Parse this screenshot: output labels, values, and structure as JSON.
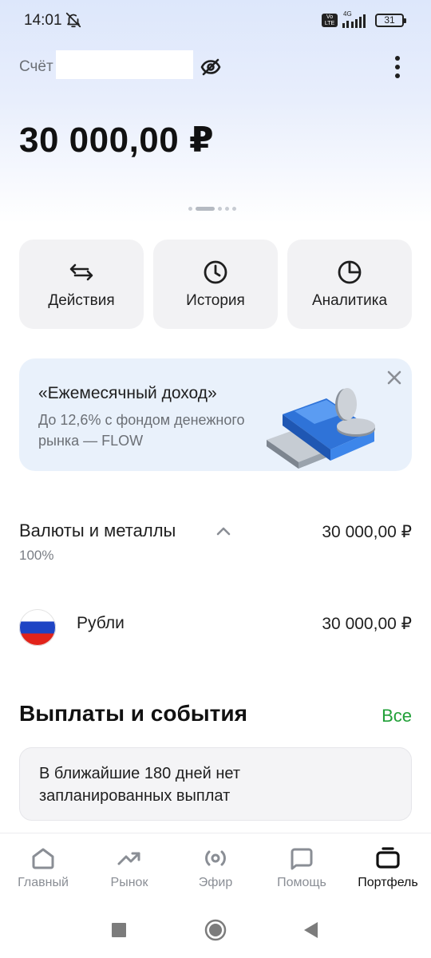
{
  "status_bar": {
    "time": "14:01",
    "network_badge": "Vo LTE",
    "network_type": "4G",
    "battery": "31"
  },
  "account": {
    "label": "Счёт",
    "balance": "30 000,00 ₽",
    "pager_count": 5,
    "pager_active": 1
  },
  "actions": [
    {
      "label": "Действия",
      "icon": "swap-arrows-icon"
    },
    {
      "label": "История",
      "icon": "clock-icon"
    },
    {
      "label": "Аналитика",
      "icon": "pie-chart-icon"
    }
  ],
  "promo": {
    "title": "«Ежемесячный доход»",
    "text": "До 12,6% с фондом денежного рынка — FLOW"
  },
  "holdings": {
    "title": "Валюты и металлы",
    "total": "30 000,00 ₽",
    "percent": "100%",
    "items": [
      {
        "name": "Рубли",
        "value": "30 000,00 ₽",
        "icon": "russia-flag-icon"
      }
    ]
  },
  "payouts": {
    "title": "Выплаты и события",
    "all_link": "Все",
    "empty_text": "В ближайшие 180 дней нет запланированных выплат"
  },
  "bottom_nav": [
    {
      "label": "Главный",
      "icon": "home-icon",
      "active": false
    },
    {
      "label": "Рынок",
      "icon": "trend-up-icon",
      "active": false
    },
    {
      "label": "Эфир",
      "icon": "broadcast-icon",
      "active": false
    },
    {
      "label": "Помощь",
      "icon": "chat-bubble-icon",
      "active": false
    },
    {
      "label": "Портфель",
      "icon": "briefcase-icon",
      "active": true
    }
  ],
  "colors": {
    "accent_green": "#21a038",
    "card_background": "#f2f2f4",
    "promo_background": "#e9f1fb"
  }
}
